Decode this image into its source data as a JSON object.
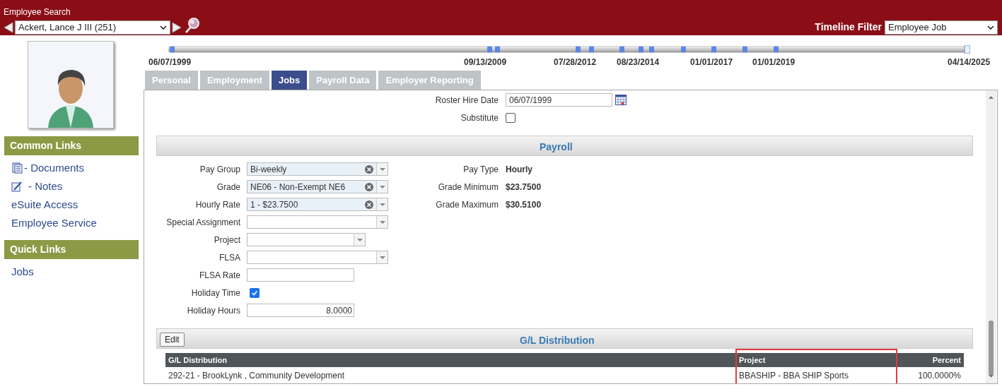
{
  "header": {
    "title": "Employee Search",
    "employee": "Ackert, Lance J III (251)",
    "timeline_filter_label": "Timeline Filter",
    "timeline_filter_value": "Employee Job"
  },
  "timeline": {
    "labels": [
      "06/07/1999",
      "09/13/2009",
      "07/28/2012",
      "08/23/2014",
      "01/01/2017",
      "01/01/2019",
      "04/14/2025"
    ]
  },
  "sidebar": {
    "sections": [
      {
        "title": "Common Links",
        "links": [
          {
            "label": "- Documents",
            "kind": "documents"
          },
          {
            "label": "- Notes",
            "kind": "notes"
          },
          {
            "label": "eSuite Access",
            "kind": "plain"
          },
          {
            "label": "Employee Service",
            "kind": "plain"
          }
        ]
      },
      {
        "title": "Quick Links",
        "links": [
          {
            "label": "Jobs",
            "kind": "plain"
          }
        ]
      }
    ]
  },
  "tabs": [
    {
      "label": "Personal",
      "selected": false
    },
    {
      "label": "Employment",
      "selected": false
    },
    {
      "label": "Jobs",
      "selected": true
    },
    {
      "label": "Payroll Data",
      "selected": false
    },
    {
      "label": "Employer Reporting",
      "selected": false
    }
  ],
  "top_fields": [
    {
      "label": "Roster Hire Date",
      "kind": "date",
      "value": "06/07/1999"
    },
    {
      "label": "Substitute",
      "kind": "checkbox",
      "checked": false
    }
  ],
  "payroll": {
    "title": "Payroll",
    "fields": [
      {
        "label": "Pay Group",
        "kind": "select",
        "value": "Bi-weekly",
        "clearable": true
      },
      {
        "label": "Grade",
        "kind": "select",
        "value": "NE06 - Non-Exempt NE6",
        "clearable": true
      },
      {
        "label": "Hourly Rate",
        "kind": "select",
        "value": "1 - $23.7500",
        "clearable": true
      },
      {
        "label": "Special Assignment",
        "kind": "select",
        "clearable": false
      },
      {
        "label": "Project",
        "kind": "select_short",
        "clearable": false
      },
      {
        "label": "FLSA",
        "kind": "select",
        "clearable": false
      },
      {
        "label": "FLSA Rate",
        "kind": "text"
      },
      {
        "label": "Holiday Time",
        "kind": "checkbox",
        "checked": true
      },
      {
        "label": "Holiday Hours",
        "kind": "number",
        "value": "8.0000"
      }
    ],
    "info": [
      {
        "label": "Pay Type",
        "value": "Hourly"
      },
      {
        "label": "Grade Minimum",
        "value": "$23.7500"
      },
      {
        "label": "Grade Maximum",
        "value": "$30.5100"
      }
    ]
  },
  "gl": {
    "title": "G/L Distribution",
    "edit_button": "Edit",
    "columns": [
      "G/L Distribution",
      "Project",
      "Percent"
    ],
    "rows": [
      [
        "292-21 - BrookLynk , Community Development",
        "BBASHIP - BBA SHIP Sports",
        "100.0000%"
      ]
    ]
  }
}
